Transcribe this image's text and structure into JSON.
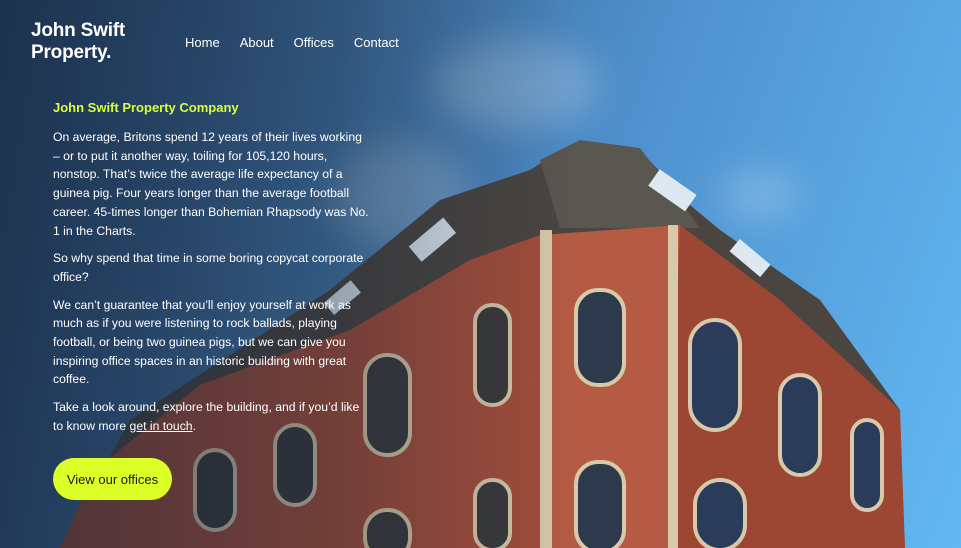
{
  "brand": {
    "line1": "John Swift",
    "line2": "Property."
  },
  "nav": [
    {
      "label": "Home"
    },
    {
      "label": "About"
    },
    {
      "label": "Offices"
    },
    {
      "label": "Contact"
    }
  ],
  "content": {
    "heading": "John Swift Property Company",
    "paragraphs": [
      "On average, Britons spend 12 years of their lives working – or to put it another way, toiling for 105,120 hours, nonstop. That’s twice the average life expectancy of a guinea pig. Four years longer than the average football career. 45-times longer than Bohemian Rhapsody was No. 1 in the Charts.",
      "So why spend that time in some boring copycat corporate office?",
      "We can’t guarantee that you’ll enjoy yourself at work as much as if you were listening to rock ballads, playing football, or being two guinea pigs, but we can give you inspiring office spaces in an historic building with great coffee."
    ],
    "last_paragraph_text": "Take a look around, explore the building, and if you’d like to know more ",
    "contact_link": "get in touch",
    "last_paragraph_end": "."
  },
  "cta_label": "View our offices",
  "colors": {
    "accent": "#dcff28",
    "heading": "#d7ff3c"
  }
}
